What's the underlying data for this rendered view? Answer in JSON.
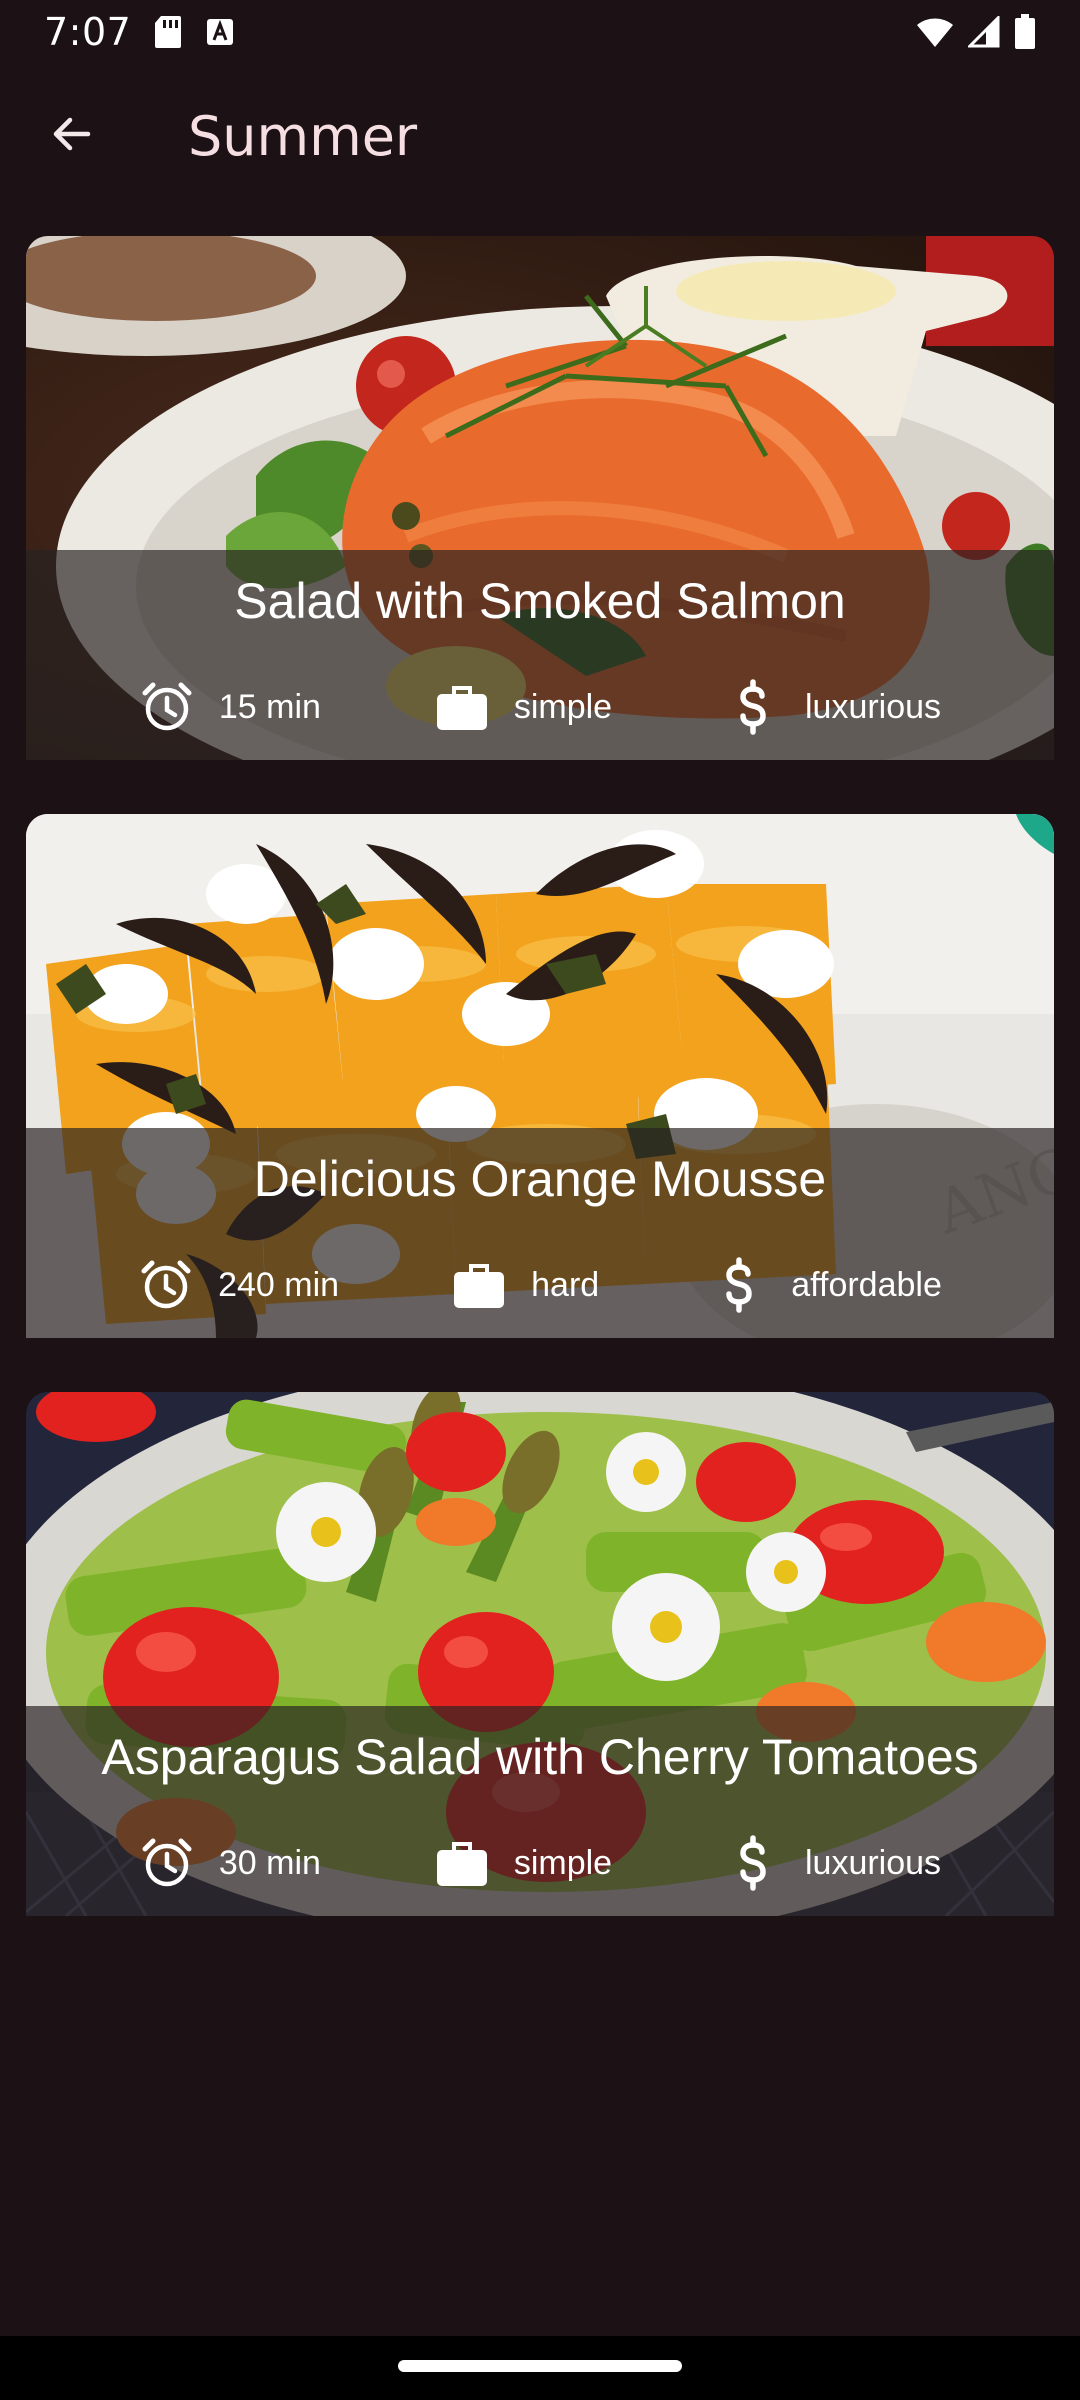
{
  "status_bar": {
    "time": "7:07",
    "icons": [
      "sd-card-icon",
      "a-keyboard-icon",
      "wifi-icon",
      "signal-icon",
      "battery-icon"
    ]
  },
  "app_bar": {
    "title": "Summer",
    "back_icon": "arrow-back-icon"
  },
  "meals": [
    {
      "title": "Salad with Smoked Salmon",
      "duration": "15 min",
      "complexity": "simple",
      "affordability": "luxurious",
      "photo": "smoked-salmon-salad"
    },
    {
      "title": "Delicious Orange Mousse",
      "duration": "240 min",
      "complexity": "hard",
      "affordability": "affordable",
      "photo": "orange-mousse-cups"
    },
    {
      "title": "Asparagus Salad with Cherry Tomatoes",
      "duration": "30 min",
      "complexity": "simple",
      "affordability": "luxurious",
      "photo": "asparagus-strawberry-salad"
    }
  ],
  "meta_icons": {
    "duration": "alarm-icon",
    "complexity": "briefcase-icon",
    "affordability": "dollar-icon"
  },
  "colors": {
    "background": "#1c1114",
    "title_text": "#f6dfe3",
    "overlay": "rgba(40,34,34,0.68)"
  }
}
